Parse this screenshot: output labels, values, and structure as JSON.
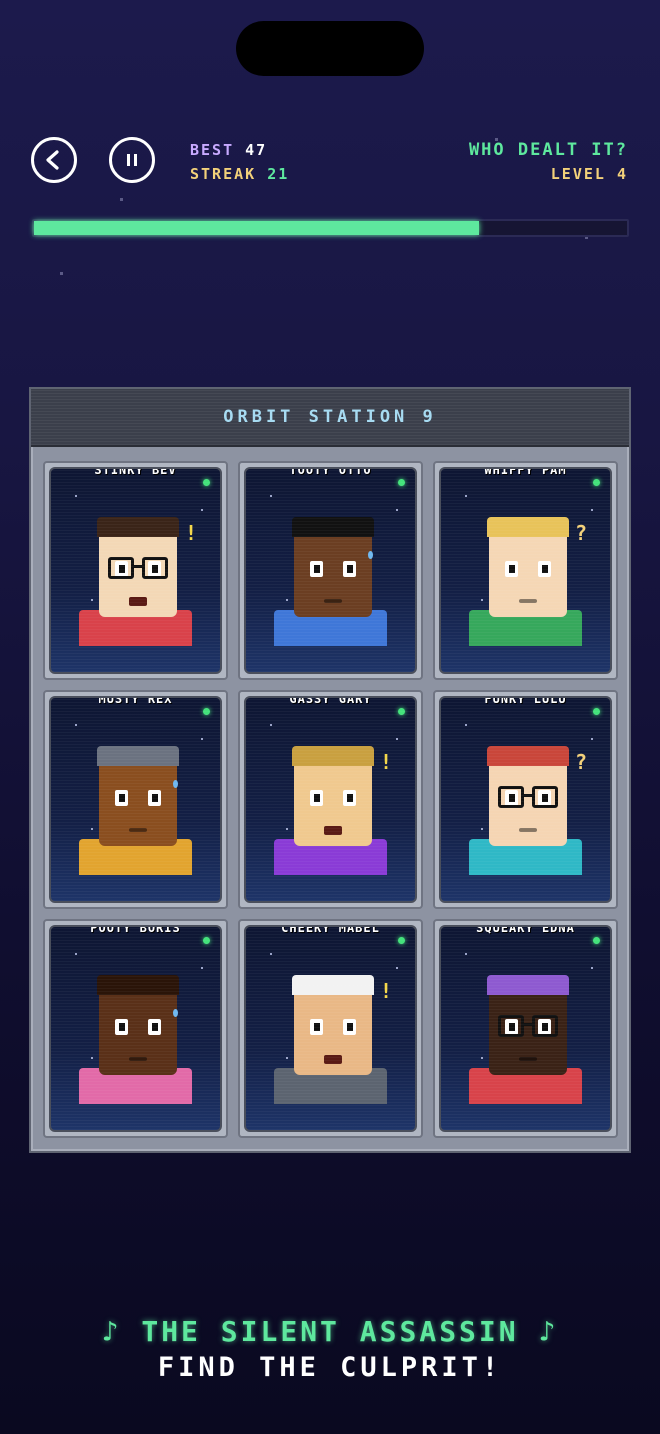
{
  "header": {
    "best_label": "BEST",
    "best_value": "47",
    "streak_label": "STREAK",
    "streak_value": "21",
    "game_title": "WHO DEALT IT?",
    "level_label": "LEVEL",
    "level_value": "4",
    "progress_fraction": 0.75
  },
  "panel": {
    "title": "ORBIT STATION 9"
  },
  "suspects": [
    {
      "name": "STINKY BEV",
      "skin": "#f3d8b6",
      "hair": "#3a2418",
      "shirt": "#d9424a",
      "glasses": true,
      "mark": "!",
      "mouth": true
    },
    {
      "name": "TOOTY OTTO",
      "skin": "#6b3e22",
      "hair": "#111111",
      "shirt": "#3f77d8",
      "glasses": false,
      "mark": "",
      "drop": true
    },
    {
      "name": "WHIFFY PAM",
      "skin": "#f5d7b5",
      "hair": "#e8c35a",
      "shirt": "#36a85c",
      "glasses": false,
      "mark": "?"
    },
    {
      "name": "MUSTY REX",
      "skin": "#8a4e1f",
      "hair": "#6b7280",
      "shirt": "#e2a42f",
      "glasses": false,
      "mark": "",
      "drop": true
    },
    {
      "name": "GASSY GARY",
      "skin": "#f0c98f",
      "hair": "#c9a040",
      "shirt": "#8a3bd6",
      "glasses": false,
      "mark": "!",
      "mouth": true
    },
    {
      "name": "FUNKY LULU",
      "skin": "#f5d5b3",
      "hair": "#c9463a",
      "shirt": "#2fb8c6",
      "glasses": true,
      "mark": "?"
    },
    {
      "name": "POOTY BORIS",
      "skin": "#5a3018",
      "hair": "#2a1408",
      "shirt": "#e26aa8",
      "glasses": false,
      "mark": "",
      "drop": true
    },
    {
      "name": "CHEEKY MABEL",
      "skin": "#e9b886",
      "hair": "#f2f2f2",
      "shirt": "#5c6470",
      "glasses": false,
      "mark": "!",
      "mouth": true
    },
    {
      "name": "SQUEAKY EDNA",
      "skin": "#3a2216",
      "hair": "#8e5ad0",
      "shirt": "#d8434a",
      "glasses": true,
      "mark": ""
    }
  ],
  "footer": {
    "tagline": "♪ THE SILENT ASSASSIN ♪",
    "subline": "FIND THE CULPRIT!"
  },
  "colors": {
    "accent_green": "#5ee89e",
    "accent_yellow": "#f3d17a",
    "accent_purple": "#c8aaff",
    "background": "#181642"
  }
}
